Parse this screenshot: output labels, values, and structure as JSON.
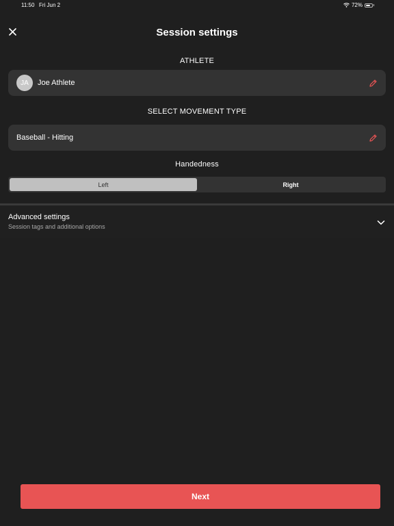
{
  "status_bar": {
    "time": "11:50",
    "date": "Fri Jun 2",
    "battery_percent_label": "72%",
    "battery_level": 0.72
  },
  "header": {
    "title": "Session settings",
    "close_icon": "close-icon"
  },
  "athlete": {
    "section_label": "ATHLETE",
    "avatar_initials": "JA",
    "name": "Joe Athlete",
    "edit_icon": "pencil-icon"
  },
  "movement": {
    "section_label": "SELECT MOVEMENT TYPE",
    "value": "Baseball - Hitting",
    "edit_icon": "pencil-icon"
  },
  "handedness": {
    "section_label": "Handedness",
    "options": [
      "Left",
      "Right"
    ],
    "selected": "Left"
  },
  "advanced": {
    "title": "Advanced settings",
    "subtitle": "Session tags and additional options",
    "chevron_icon": "chevron-down-icon"
  },
  "footer": {
    "next_label": "Next"
  },
  "colors": {
    "background": "#1f1f1f",
    "card": "#333333",
    "accent": "#e85454",
    "segment_active": "#c0c0c0",
    "edit_icon": "#e85454"
  }
}
